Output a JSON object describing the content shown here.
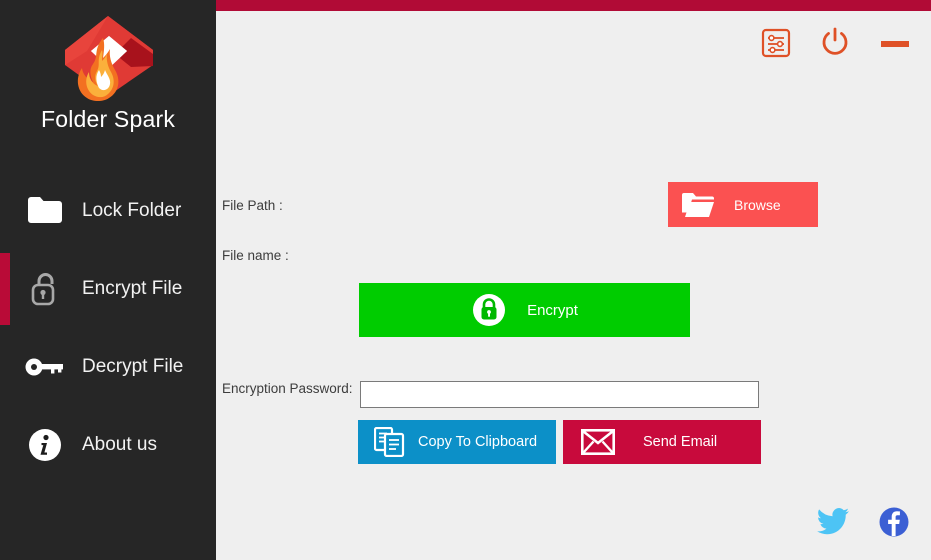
{
  "app": {
    "brand_name": "Folder Spark",
    "logo_icon": "flame-folder-logo"
  },
  "colors": {
    "sidebar_bg": "#262626",
    "main_bg": "#efefef",
    "topbar": "#b10b36",
    "active_indicator": "#b90b37",
    "browse_btn": "#fb5151",
    "encrypt_btn": "#00cc00",
    "copy_btn": "#0c90c8",
    "email_btn": "#c80a3c",
    "window_icon": "#df5127",
    "twitter": "#4dc4f5",
    "facebook": "#3b5fd4"
  },
  "sidebar": {
    "items": [
      {
        "label": "Lock Folder",
        "icon": "folder-icon",
        "active": false
      },
      {
        "label": "Encrypt File",
        "icon": "lock-icon",
        "active": true
      },
      {
        "label": "Decrypt File",
        "icon": "key-icon",
        "active": false
      },
      {
        "label": "About us",
        "icon": "info-icon",
        "active": false
      }
    ]
  },
  "window_controls": {
    "settings": {
      "label": "Settings",
      "icon": "sliders-settings-icon"
    },
    "power": {
      "label": "Power",
      "icon": "power-icon"
    },
    "minimize": {
      "label": "Minimize",
      "icon": "minimize-icon"
    }
  },
  "main": {
    "file_path": {
      "label": "File Path :",
      "value": ""
    },
    "file_name": {
      "label": "File name :",
      "value": ""
    },
    "browse_button": {
      "label": "Browse",
      "icon": "folder-open-icon"
    },
    "encrypt_button": {
      "label": "Encrypt",
      "icon": "lock-circle-icon"
    },
    "password": {
      "label": "Encryption Password:",
      "value": "",
      "placeholder": ""
    },
    "copy_button": {
      "label": "Copy To Clipboard",
      "icon": "copy-icon"
    },
    "email_button": {
      "label": "Send Email",
      "icon": "envelope-icon"
    }
  },
  "social": {
    "twitter": {
      "label": "Twitter",
      "icon": "twitter-icon"
    },
    "facebook": {
      "label": "Facebook",
      "icon": "facebook-icon"
    }
  }
}
